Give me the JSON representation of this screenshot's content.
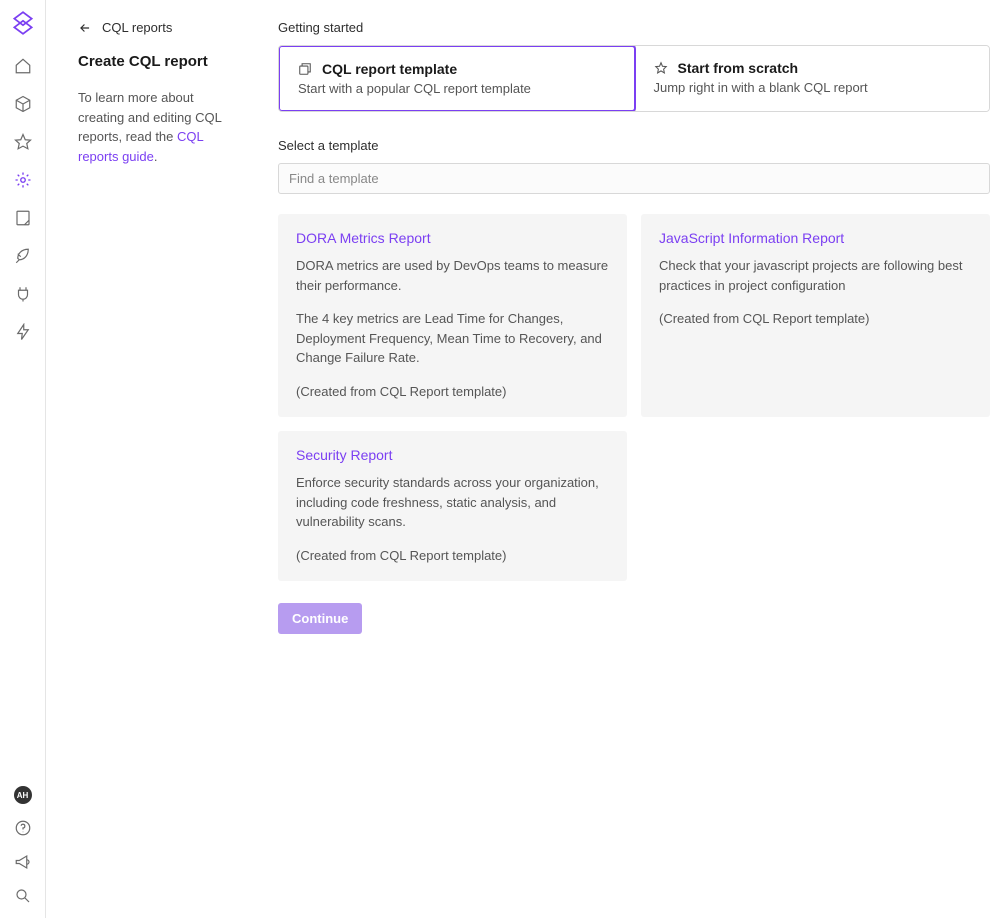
{
  "sidebar": {
    "avatar": "AH",
    "nav": [
      {
        "name": "home-icon"
      },
      {
        "name": "cube-icon"
      },
      {
        "name": "star-icon"
      },
      {
        "name": "gear-icon",
        "active": true
      },
      {
        "name": "note-icon"
      },
      {
        "name": "rocket-icon"
      },
      {
        "name": "plug-icon"
      },
      {
        "name": "bolt-icon"
      }
    ],
    "bottom": [
      {
        "name": "help-icon"
      },
      {
        "name": "megaphone-icon"
      },
      {
        "name": "search-icon"
      }
    ]
  },
  "breadcrumb": "CQL reports",
  "page_title": "Create CQL report",
  "help": {
    "text_before": "To learn more about creating and editing CQL reports, read the ",
    "link": "CQL reports guide",
    "text_after": "."
  },
  "getting_started": {
    "label": "Getting started",
    "options": [
      {
        "icon": "template-icon",
        "title": "CQL report template",
        "subtitle": "Start with a popular CQL report template",
        "selected": true
      },
      {
        "icon": "star-outline-icon",
        "title": "Start from scratch",
        "subtitle": "Jump right in with a blank CQL report",
        "selected": false
      }
    ]
  },
  "select_template": {
    "label": "Select a template",
    "search_placeholder": "Find a template"
  },
  "templates": [
    {
      "title": "DORA Metrics Report",
      "paragraphs": [
        "DORA metrics are used by DevOps teams to measure their performance.",
        "The 4 key metrics are Lead Time for Changes, Deployment Frequency, Mean Time to Recovery, and Change Failure Rate.",
        "(Created from CQL Report template)"
      ]
    },
    {
      "title": "JavaScript Information Report",
      "paragraphs": [
        "Check that your javascript projects are following best practices in project configuration",
        "(Created from CQL Report template)"
      ]
    },
    {
      "title": "Security Report",
      "paragraphs": [
        "Enforce security standards across your organization, including code freshness, static analysis, and vulnerability scans.",
        "(Created from CQL Report template)"
      ]
    }
  ],
  "continue_label": "Continue"
}
